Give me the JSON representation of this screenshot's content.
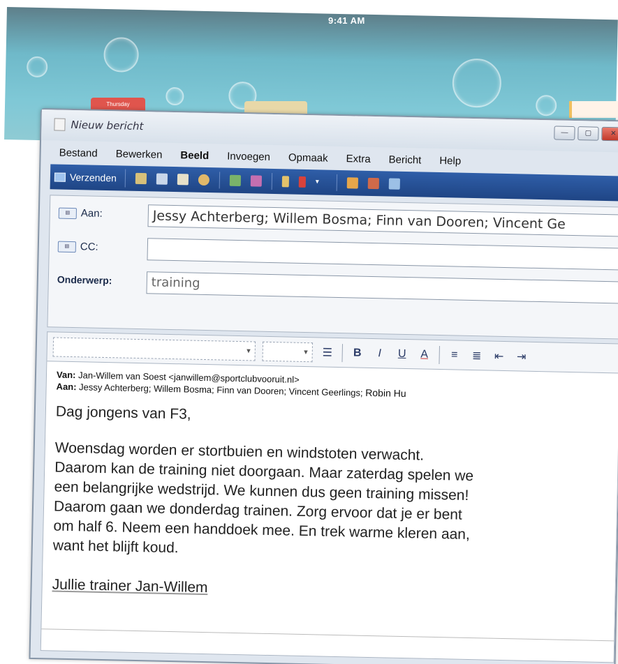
{
  "status_bar": {
    "time": "9:41 AM"
  },
  "desktop": {
    "calendar_day": "Thursday"
  },
  "window": {
    "title": "Nieuw bericht",
    "controls": {
      "minimize": "—",
      "maximize": "▢",
      "close": "✕"
    }
  },
  "menu": [
    "Bestand",
    "Bewerken",
    "Beeld",
    "Invoegen",
    "Opmaak",
    "Extra",
    "Bericht",
    "Help"
  ],
  "toolbar": {
    "send_label": "Verzenden",
    "icons": [
      "cut-icon",
      "copy-icon",
      "paste-icon",
      "undo-icon",
      "address-book-icon",
      "spellcheck-icon",
      "attach-icon",
      "priority-icon",
      "dropdown-icon",
      "sign-icon",
      "encrypt-icon",
      "offline-icon"
    ]
  },
  "fields": {
    "to_label": "Aan:",
    "to_value": "Jessy Achterberg; Willem Bosma; Finn van Dooren; Vincent Ge",
    "cc_label": "CC:",
    "cc_value": "",
    "subject_label": "Onderwerp:",
    "subject_value": "training"
  },
  "message": {
    "from_label": "Van:",
    "from_value": "Jan-Willem van Soest <janwillem@sportclubvooruit.nl>",
    "to_label": "Aan:",
    "to_value": "Jessy Achterberg; Willem Bosma; Finn van Dooren; Vincent Geerlings;",
    "to_value_cont": "Robin Hu",
    "greeting": "Dag jongens van F3,",
    "lines": [
      "Woensdag worden er stortbuien en windstoten verwacht.",
      "Daarom kan de training niet doorgaan. Maar zaterdag spelen we",
      "een belangrijke wedstrijd. We kunnen dus geen training missen!",
      "Daarom gaan we donderdag trainen. Zorg ervoor dat je er bent",
      "om half 6. Neem een handdoek mee. En trek warme kleren aan,",
      "want het blijft koud."
    ],
    "signature": "Jullie trainer Jan-Willem"
  },
  "colors": {
    "toolbar_blue": "#2f5ea8",
    "window_chrome": "#dfe6ef",
    "close_red": "#c2392a"
  }
}
